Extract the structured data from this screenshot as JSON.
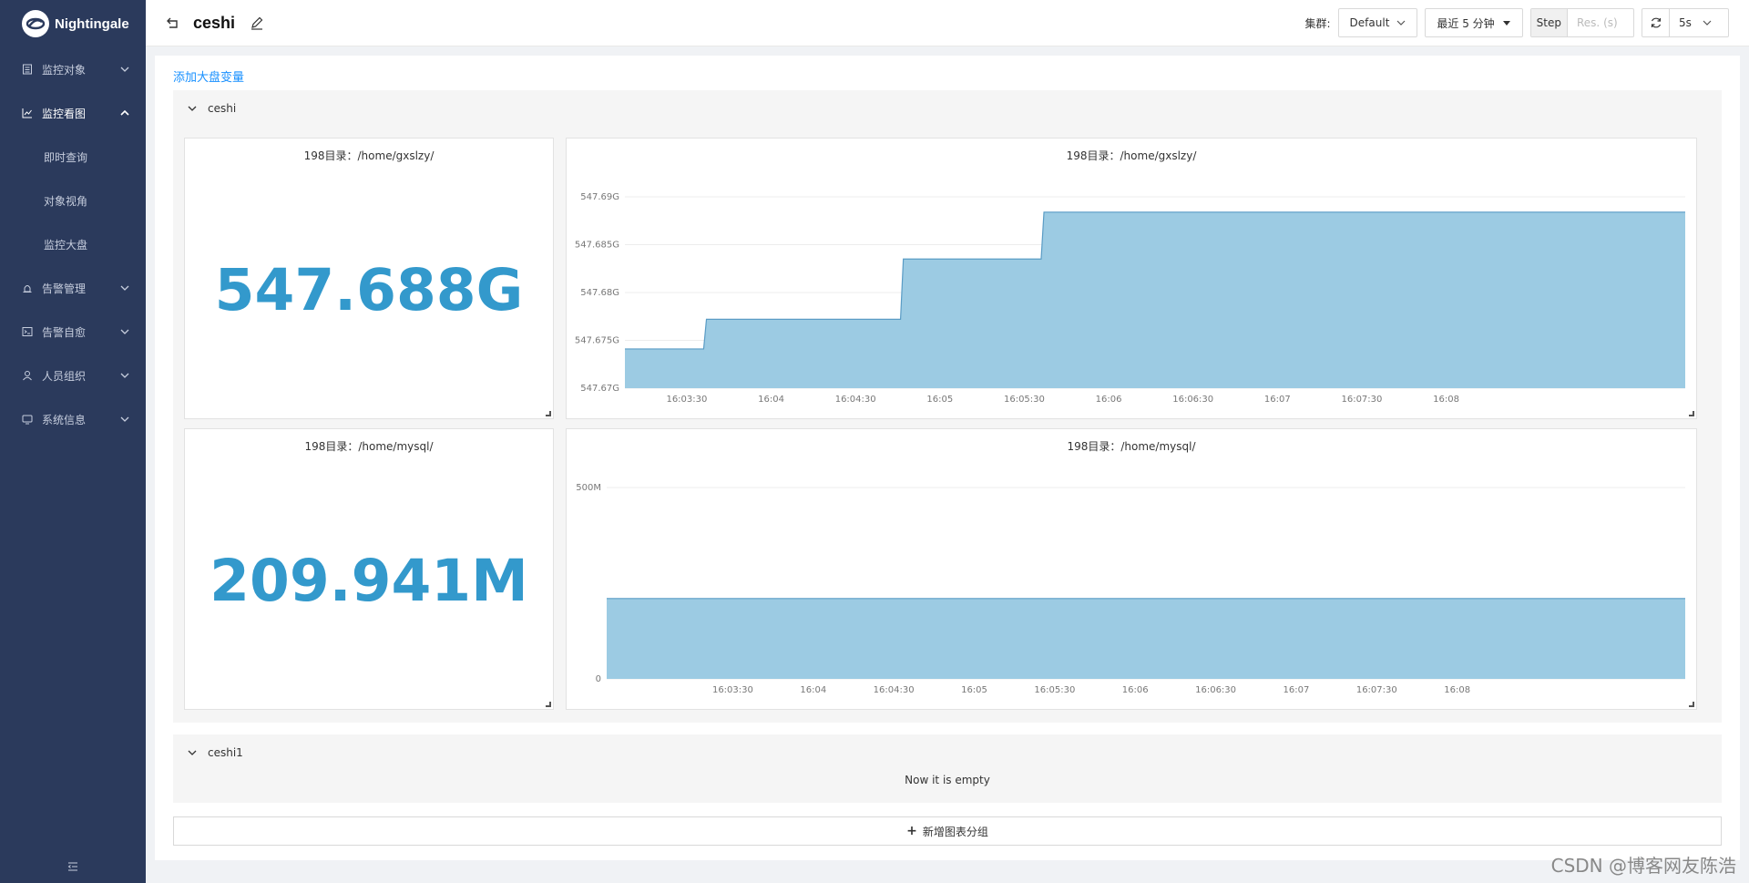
{
  "app": {
    "logo_text": "Nightingale"
  },
  "sidebar": {
    "items": [
      {
        "label": "监控对象",
        "icon": "list-icon",
        "expanded": false
      },
      {
        "label": "监控看图",
        "icon": "chart-icon",
        "expanded": true
      },
      {
        "label": "告警管理",
        "icon": "alarm-icon",
        "expanded": false
      },
      {
        "label": "告警自愈",
        "icon": "terminal-icon",
        "expanded": false
      },
      {
        "label": "人员组织",
        "icon": "user-icon",
        "expanded": false
      },
      {
        "label": "系统信息",
        "icon": "info-icon",
        "expanded": false
      }
    ],
    "sub_items": [
      "即时查询",
      "对象视角",
      "监控大盘"
    ]
  },
  "header": {
    "title": "ceshi",
    "cluster_label": "集群:",
    "cluster_value": "Default",
    "time_range": "最近 5 分钟",
    "step_label": "Step",
    "step_placeholder": "Res. (s)",
    "refresh_interval": "5s"
  },
  "content": {
    "add_variable": "添加大盘变量",
    "add_group": "新增图表分组",
    "groups": [
      {
        "name": "ceshi",
        "panels": [
          {
            "type": "stat",
            "title": "198目录：/home/gxslzy/",
            "value": "547.688G"
          },
          {
            "type": "area",
            "title": "198目录：/home/gxslzy/"
          },
          {
            "type": "stat",
            "title": "198目录：/home/mysql/",
            "value": "209.941M"
          },
          {
            "type": "area",
            "title": "198目录：/home/mysql/"
          }
        ]
      },
      {
        "name": "ceshi1",
        "empty_text": "Now it is empty"
      }
    ]
  },
  "watermark": "CSDN @博客网友陈浩",
  "colors": {
    "accent": "#3399cc",
    "area_fill": "#9ccbe3",
    "area_line": "#5a9cc5",
    "sidebar": "#2b3a5c",
    "link": "#1890ff"
  },
  "chart_data": [
    {
      "type": "area",
      "title": "198目录：/home/gxslzy/",
      "x_ticks": [
        "16:03:30",
        "16:04",
        "16:04:30",
        "16:05",
        "16:05:30",
        "16:06",
        "16:06:30",
        "16:07",
        "16:07:30",
        "16:08"
      ],
      "y_ticks": [
        "547.67G",
        "547.675G",
        "547.68G",
        "547.685G",
        "547.69G"
      ],
      "ylim": [
        547.67,
        547.69
      ],
      "xlim_sec": [
        8,
        385
      ],
      "step": true,
      "points": [
        {
          "t": 8,
          "v": 547.6741
        },
        {
          "t": 36,
          "v": 547.6741
        },
        {
          "t": 37,
          "v": 547.6772
        },
        {
          "t": 106,
          "v": 547.6772
        },
        {
          "t": 107,
          "v": 547.6835
        },
        {
          "t": 156,
          "v": 547.6835
        },
        {
          "t": 157,
          "v": 547.6884
        },
        {
          "t": 385,
          "v": 547.6884
        }
      ]
    },
    {
      "type": "area",
      "title": "198目录：/home/mysql/",
      "x_ticks": [
        "16:03:30",
        "16:04",
        "16:04:30",
        "16:05",
        "16:05:30",
        "16:06",
        "16:06:30",
        "16:07",
        "16:07:30",
        "16:08"
      ],
      "y_ticks": [
        "0",
        "500M"
      ],
      "ylim": [
        0,
        500
      ],
      "xlim_sec": [
        -17,
        385
      ],
      "step": true,
      "points": [
        {
          "t": -17,
          "v": 209.941
        },
        {
          "t": 385,
          "v": 209.941
        }
      ]
    }
  ]
}
